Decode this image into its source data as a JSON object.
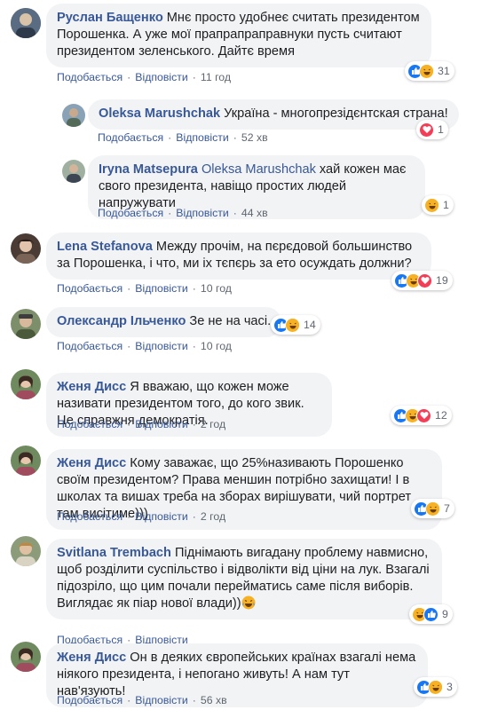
{
  "labels": {
    "like": "Подобається",
    "reply": "Відповісти",
    "dot": "·"
  },
  "comments": [
    {
      "author": "Руслан Бащенко",
      "text": "Мнє просто удобнеє считать президентом Порошенка. А уже мої прапрапраправнуки пусть считают президентом зеленського. Дайтє время",
      "time": "11 год",
      "reactions": [
        "like",
        "haha"
      ],
      "count": "31"
    },
    {
      "author": "Oleksa Marushchak",
      "text": "Україна - многопрезідєнтская страна!",
      "time": "52 хв",
      "reactions": [
        "love"
      ],
      "count": "1"
    },
    {
      "author": "Iryna Matsepura",
      "mention": "Oleksa Marushchak",
      "text": "хай кожен має свого президента, навіщо простих людей напружувати",
      "time": "44 хв",
      "reactions": [
        "haha"
      ],
      "count": "1"
    },
    {
      "author": "Lena Stefanova",
      "text": "Между прочім, на пєрєдовой большинство за Порошенка, і что, ми іх тєпєрь за ето осуждать должни?",
      "time": "10 год",
      "reactions": [
        "like",
        "haha",
        "love"
      ],
      "count": "19"
    },
    {
      "author": "Олександр Ільченко",
      "text": "Зе не на часі.",
      "time": "10 год",
      "reactions": [
        "like",
        "haha"
      ],
      "count": "14"
    },
    {
      "author": "Женя Дисс",
      "text": "Я вважаю, що кожен може називати президентом того, до кого звик. Це справжня демократія.",
      "time": "2 год",
      "reactions": [
        "like",
        "haha",
        "love"
      ],
      "count": "12"
    },
    {
      "author": "Женя Дисс",
      "text": "Кому заважає, що 25%називають Порошенко своїм президентом? Права меншин потрібно захищати! І в школах та вишах треба на зборах вирішувати, чий портрет там висітиме)))",
      "time": "2 год",
      "reactions": [
        "like",
        "haha"
      ],
      "count": "7"
    },
    {
      "author": "Svitlana Trembach",
      "text": "Піднімають вигадану проблему навмисно, щоб розділити суспільство і відволікти від ціни на лук. Взагалі підозріло, що цим почали перейматись саме після виборів. Виглядає як піар нової влади))",
      "time": "",
      "reactions": [
        "haha",
        "like"
      ],
      "count": "9"
    },
    {
      "author": "Женя Дисс",
      "text": "Он в деяких європейських країнах взагалі нема ніякого президента, і непогано живуть! А нам тут нав'язують!",
      "time": "56 хв",
      "reactions": [
        "like",
        "haha"
      ],
      "count": "3"
    }
  ],
  "colors": {
    "link": "#385898",
    "bubble": "#f2f3f5",
    "like": "#1877f2",
    "haha": "#f7b125",
    "love": "#f33e58"
  }
}
